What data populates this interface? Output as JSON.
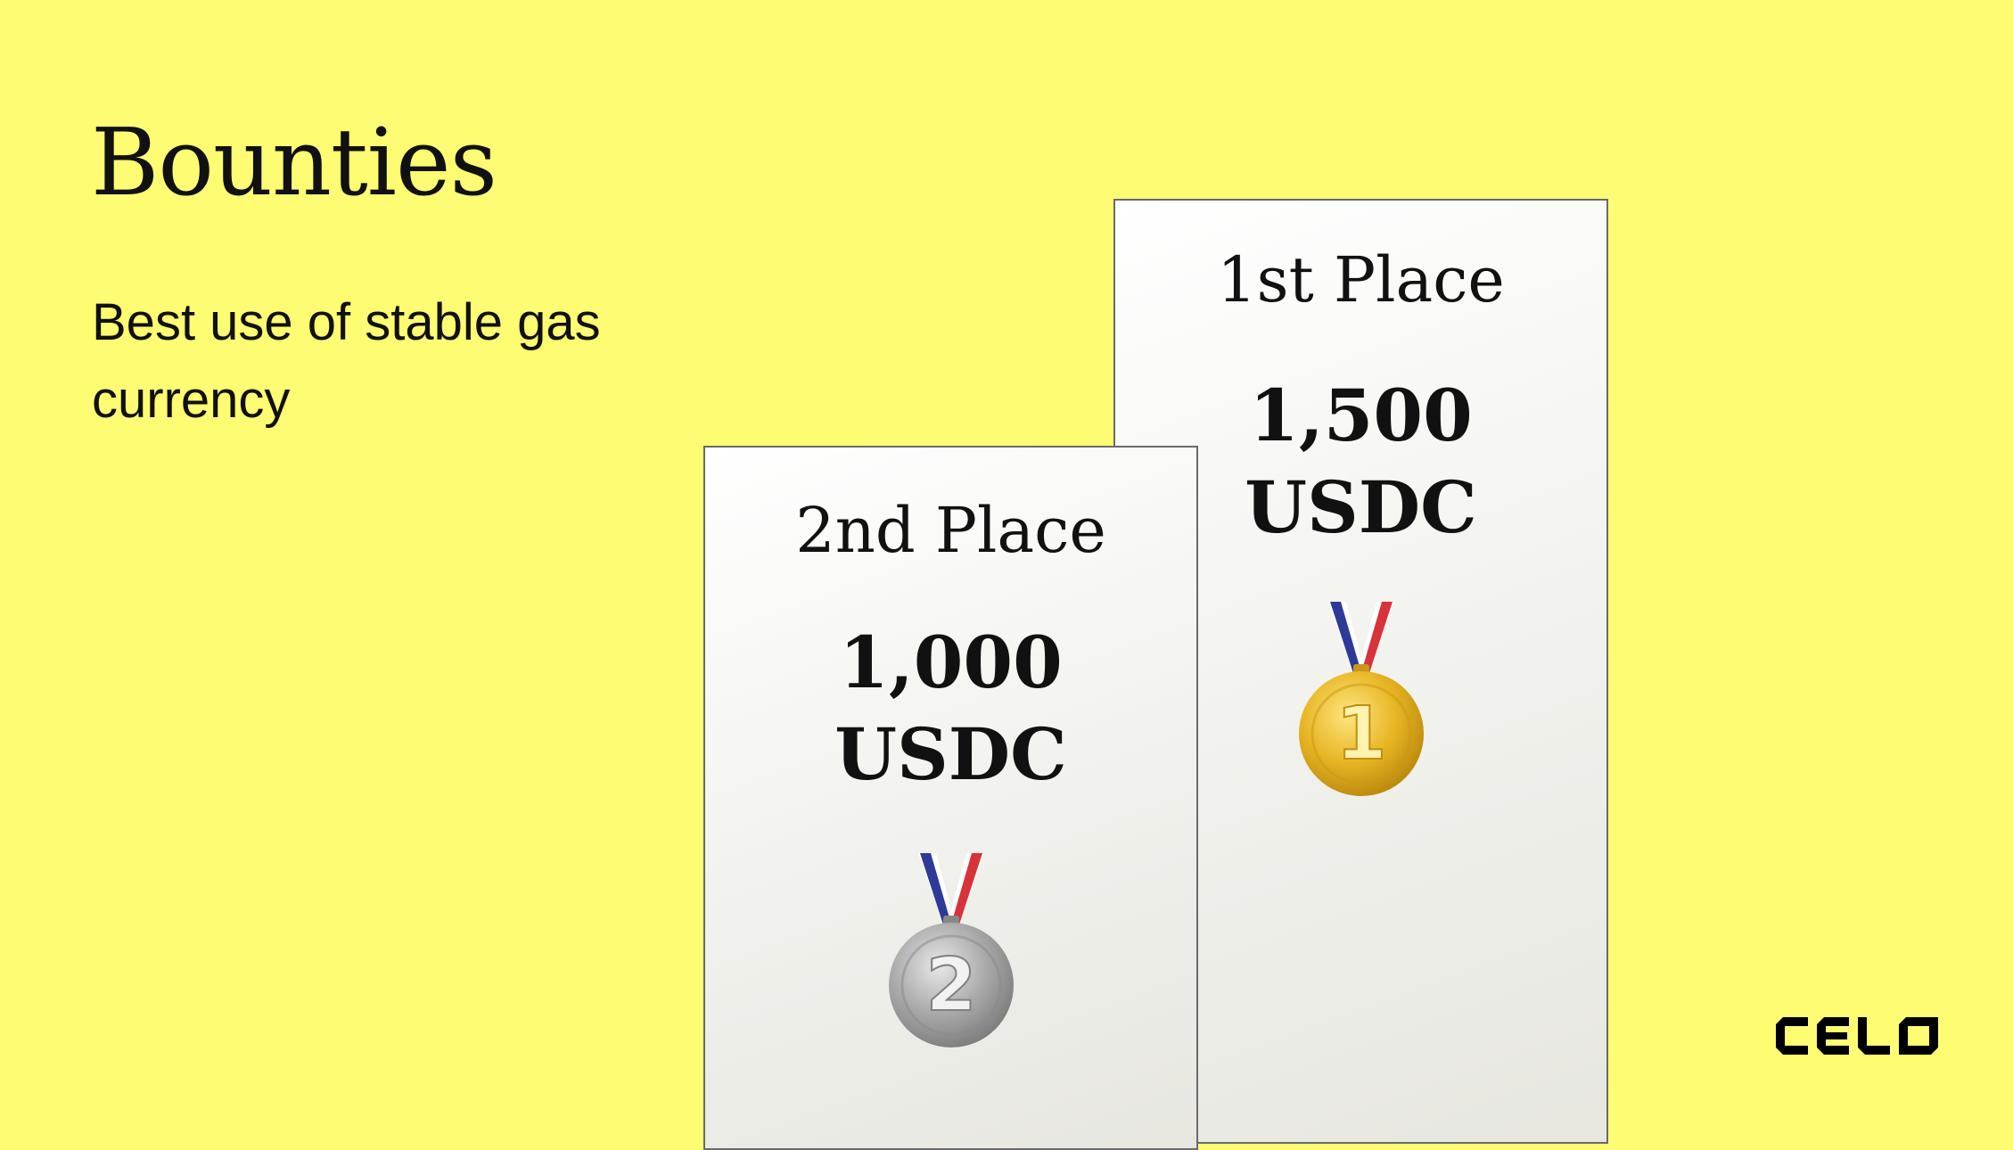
{
  "slide": {
    "title": "Bounties",
    "subtitle": "Best use of stable gas currency",
    "background_color": "#FEFC72"
  },
  "prizes": [
    {
      "place": "1st Place",
      "amount": "1,500",
      "currency": "USDC",
      "medal_icon": "gold-medal-icon",
      "medal_number": "1"
    },
    {
      "place": "2nd Place",
      "amount": "1,000",
      "currency": "USDC",
      "medal_icon": "silver-medal-icon",
      "medal_number": "2"
    }
  ],
  "logo": {
    "icon": "celo-logo-icon",
    "text": "CELO"
  }
}
